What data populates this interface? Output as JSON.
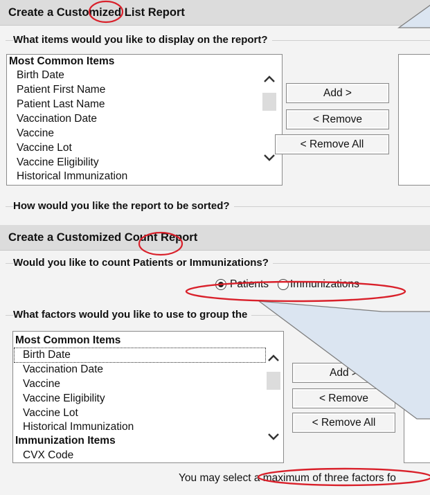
{
  "list_report": {
    "title": "Create a Customized List Report",
    "question_items": "What items would you like to display on the report?",
    "group_label": "Most Common Items",
    "items": [
      "Birth Date",
      "Patient First Name",
      "Patient Last Name",
      "Vaccination Date",
      "Vaccine",
      "Vaccine Lot",
      "Vaccine Eligibility",
      "Historical Immunization"
    ],
    "add_label": "Add >",
    "remove_label": "< Remove",
    "remove_all_label": "< Remove All",
    "question_sort": "How would you like the report to be sorted?"
  },
  "count_report": {
    "title": "Create a Customized Count Report",
    "question_count": "Would you like to count Patients or Immunizations?",
    "radio_patients": "Patients",
    "radio_immunizations": "Immunizations",
    "question_group": "What factors would you like to use to group the",
    "group_label": "Most Common Items",
    "items": [
      "Birth Date",
      "Vaccination Date",
      "Vaccine",
      "Vaccine Eligibility",
      "Vaccine Lot",
      "Historical Immunization"
    ],
    "group_label_2": "Immunization Items",
    "items_2": [
      "CVX Code"
    ],
    "add_label": "Add >",
    "remove_label": "< Remove",
    "remove_all_label": "< Remove All",
    "note": "You may select a maximum of three factors fo"
  },
  "colors": {
    "callout_fill": "#dbe5f1",
    "callout_stroke": "#7f7f7f",
    "highlight": "#d9202a"
  },
  "icons": {
    "scroll_up": "chevron-up-icon",
    "scroll_down": "chevron-down-icon"
  }
}
